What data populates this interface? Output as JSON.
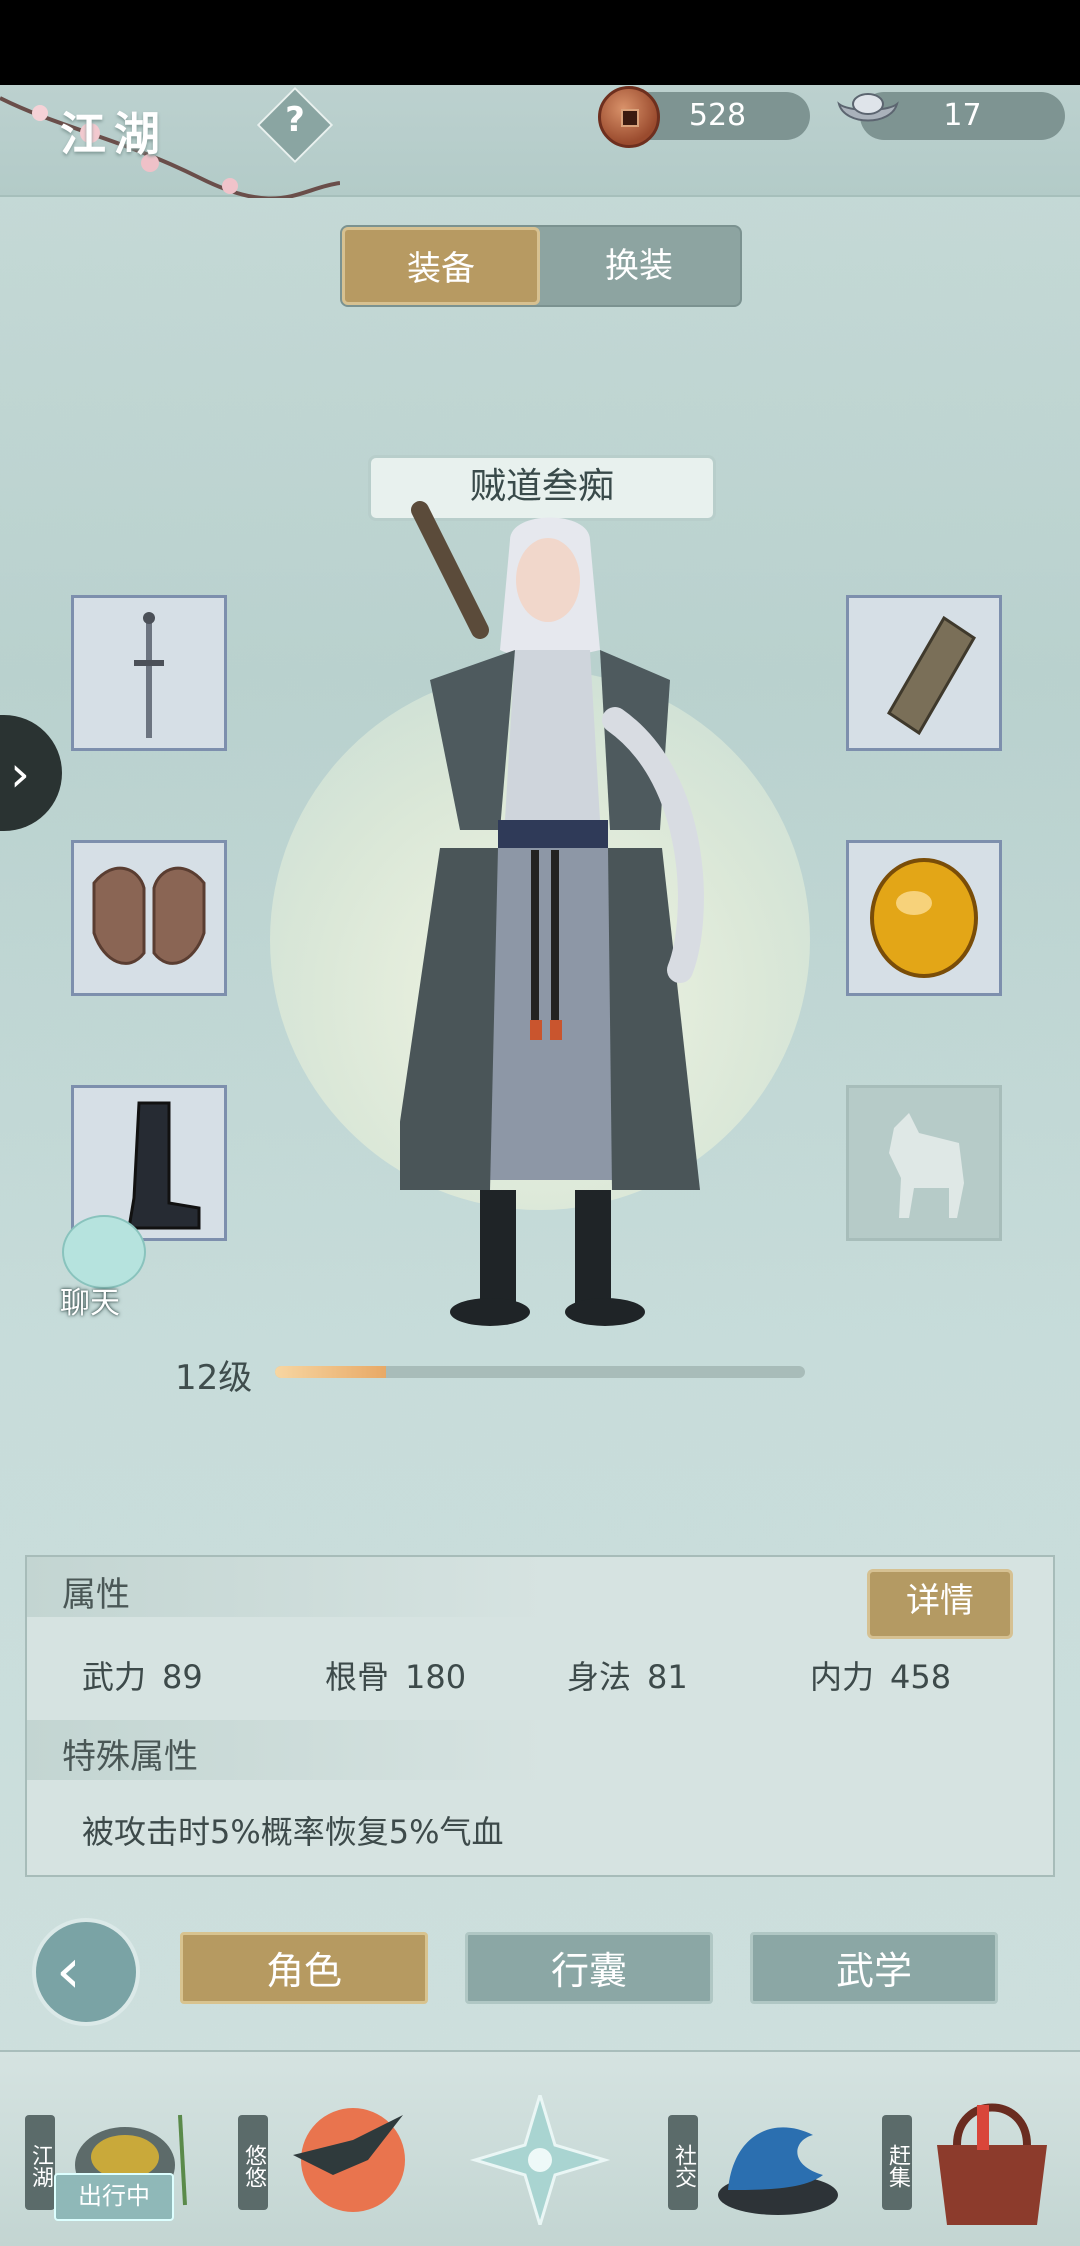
{
  "header": {
    "title": "江湖",
    "help_symbol": "?",
    "currency": [
      {
        "icon": "copper-coin-icon",
        "value": "528"
      },
      {
        "icon": "silver-ingot-icon",
        "value": "17"
      }
    ]
  },
  "tabs": {
    "active": "装备",
    "inactive": "换装"
  },
  "character": {
    "name": "贼道叁痴",
    "level_label": "12级",
    "level_progress": 0.21
  },
  "equipment": {
    "left": [
      "sword-icon",
      "armor-icon",
      "boots-icon"
    ],
    "right": [
      "bracer-icon",
      "amber-gem-icon",
      "horse-icon"
    ]
  },
  "chat": {
    "label": "聊天"
  },
  "attributes": {
    "heading": "属性",
    "detail_button": "详情",
    "stats": [
      {
        "name": "武力",
        "value": "89"
      },
      {
        "name": "根骨",
        "value": "180"
      },
      {
        "name": "身法",
        "value": "81"
      },
      {
        "name": "内力",
        "value": "458"
      }
    ],
    "special_heading": "特殊属性",
    "special_text": "被攻击时5%概率恢复5%气血"
  },
  "bottom_tabs": {
    "role": "角色",
    "bag": "行囊",
    "martial": "武学"
  },
  "nav": {
    "jianghu": "江湖",
    "youyou": "悠悠",
    "social": "社交",
    "market": "赶集",
    "out_badge": "出行中"
  },
  "colors": {
    "gold": "#b69a61",
    "teal": "#8ba7a5",
    "progress": "#e8a966"
  }
}
